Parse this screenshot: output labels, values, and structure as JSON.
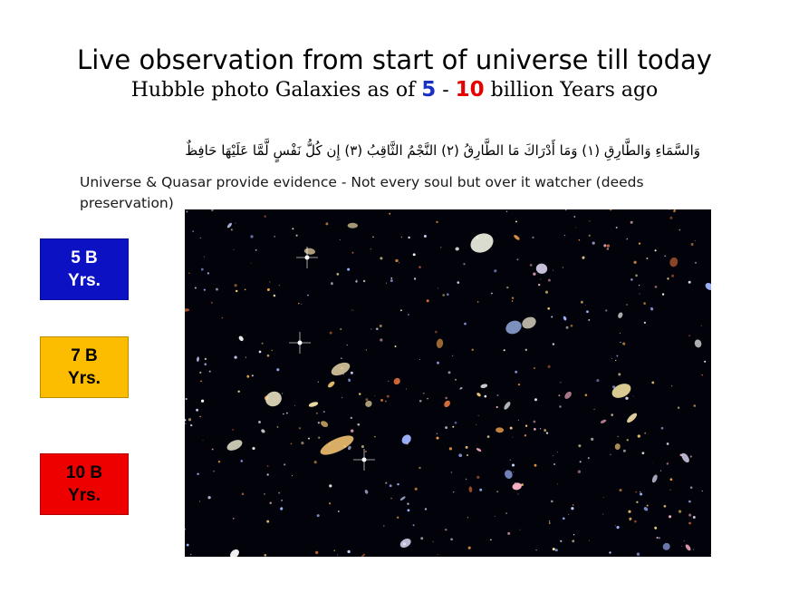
{
  "slide": {
    "title": "Live observation from start of universe till today",
    "subtitle_prefix": "Hubble photo Galaxies as of ",
    "subtitle_num1": "5",
    "subtitle_sep": " - ",
    "subtitle_num2": "10",
    "subtitle_suffix": " billion Years ago",
    "arabic_verse": "وَالسَّمَاءِ وَالطَّارِقِ (١) وَمَا أَدْرَاكَ مَا الطَّارِقُ (٢) النَّجْمُ الثَّاقِبُ (٣) إِن كُلُّ نَفْسٍ لَّمَّا عَلَيْهَا حَافِظٌ",
    "english_line": "Universe & Quasar provide evidence - Not every soul but over it watcher (deeds preservation)"
  },
  "badges": [
    {
      "label": "5 B\nYrs.",
      "bg": "#0c12c4",
      "fg": "#ffffff"
    },
    {
      "label": "7 B\nYrs.",
      "bg": "#fcbd00",
      "fg": "#000000"
    },
    {
      "label": "10 B\nYrs.",
      "bg": "#ee0000",
      "fg": "#000000"
    }
  ],
  "colors": {
    "subtitle_num1": "#1a2fc4",
    "subtitle_num2": "#e60000",
    "photo_background": "#02030a"
  }
}
